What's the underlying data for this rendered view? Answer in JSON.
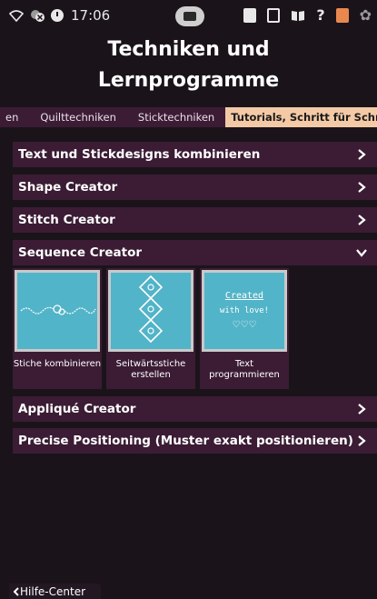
{
  "status_bar": {
    "time": "17:06"
  },
  "title_lines": [
    "Techniken und",
    "Lernprogramme"
  ],
  "tabs": [
    "en",
    "Quilttechniken",
    "Sticktechniken",
    "Tutorials, Schritt für Schritt"
  ],
  "accordion": [
    {
      "label": "Text und Stickdesigns kombinieren",
      "expanded": false
    },
    {
      "label": "Shape Creator",
      "expanded": false
    },
    {
      "label": "Stitch Creator",
      "expanded": false
    },
    {
      "label": "Sequence Creator",
      "expanded": true
    },
    {
      "label": "Appliqué Creator",
      "expanded": false
    },
    {
      "label": "Precise Positioning (Muster exakt positionieren)",
      "expanded": false
    }
  ],
  "tiles": [
    {
      "label": "Stiche kombinieren"
    },
    {
      "label": "Seitwärtsstiche erstellen"
    },
    {
      "label": "Text programmieren"
    }
  ],
  "tile3_preview": [
    "Created",
    "with love!",
    "♡♡♡"
  ],
  "help_button": "Hilfe-Center",
  "colors": {
    "accent_tab": "#f3c9a6",
    "row_bg": "#3b1c34",
    "tile_bg": "#52b4c8",
    "page_bg": "#1a141a"
  }
}
